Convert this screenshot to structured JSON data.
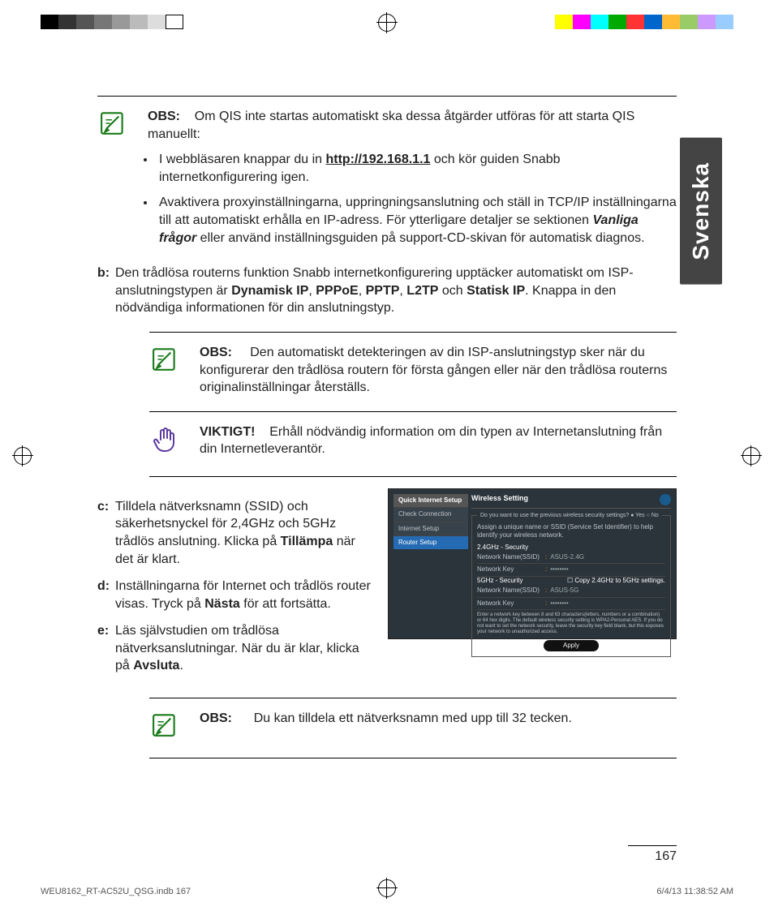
{
  "language_tab": "Svenska",
  "page_number": "167",
  "imprint": {
    "file": "WEU8162_RT-AC52U_QSG.indb   167",
    "stamp": "6/4/13   11:38:52 AM"
  },
  "note1": {
    "label": "OBS:",
    "intro": "Om QIS inte startas automatiskt ska dessa åtgärder utföras för att starta QIS manuellt:",
    "bullet1_a": "I webbläsaren knappar du in ",
    "bullet1_link": "http://192.168.1.1",
    "bullet1_b": " och kör guiden Snabb internetkonfigurering igen.",
    "bullet2_a": "Avaktivera proxyinställningarna, uppringningsanslutning och ställ in TCP/IP inställningarna till att automatiskt erhålla en IP-adress. För ytterligare detaljer se sektionen ",
    "bullet2_em": "Vanliga frågor",
    "bullet2_b": " eller använd inställningsguiden på support-CD-skivan för automatisk diagnos."
  },
  "step_b": {
    "label": "b:",
    "a": "Den trådlösa routerns funktion Snabb internetkonfigurering upptäcker automatiskt om ISP-anslutningstypen är ",
    "b1": "Dynamisk IP",
    "c1": ", ",
    "b2": "PPPoE",
    "c2": ", ",
    "b3": "PPTP",
    "c3": ", ",
    "b4": "L2TP",
    "c4": " och ",
    "b5": "Statisk IP",
    "tail": ". Knappa in den nödvändiga informationen för din anslutningstyp."
  },
  "note2": {
    "label": "OBS:",
    "text": "Den automatiskt detekteringen av din ISP-anslutningstyp sker när du konfigurerar den trådlösa routern för första gången eller när den trådlösa routerns originalinställningar återställs."
  },
  "important": {
    "label": "VIKTIGT!",
    "text": "Erhåll nödvändig information om din typen av Internetanslutning från din Internetleverantör."
  },
  "step_c": {
    "label": "c:",
    "a": "Tilldela nätverksnamn (SSID) och säkerhetsnyckel för 2,4GHz och 5GHz trådlös anslutning. Klicka på ",
    "bold": "Tillämpa",
    "b": " när det är klart."
  },
  "step_d": {
    "label": "d:",
    "a": "Inställningarna för Internet och trådlös router visas. Tryck på ",
    "bold": "Nästa",
    "b": " för att fortsätta."
  },
  "step_e": {
    "label": "e:",
    "a": "Läs självstudien om trådlösa nätverksanslutningar. När du är klar, klicka på ",
    "bold": "Avsluta",
    "b": "."
  },
  "note3": {
    "label": "OBS:",
    "text": "Du kan tilldela ett nätverksnamn med upp till 32 tecken."
  },
  "router": {
    "side_hdr": "Quick Internet Setup",
    "side1": "Check Connection",
    "side2": "Internet Setup",
    "side3": "Router Setup",
    "title": "Wireless Setting",
    "question": "Do you want to use the previous wireless security settings?",
    "yes": "● Yes",
    "no": "○ No",
    "hint": "Assign a unique name or SSID (Service Set Identifier) to help identify your wireless network.",
    "g1": "2.4GHz - Security",
    "f1k": "Network Name(SSID)",
    "f1v": "ASUS-2.4G",
    "f2k": "Network Key",
    "f2v": "••••••••",
    "g2": "5GHz - Security",
    "g2chk": "☐ Copy 2.4GHz to 5GHz settings.",
    "f3k": "Network Name(SSID)",
    "f3v": "ASUS-5G",
    "f4k": "Network Key",
    "f4v": "••••••••",
    "note": "Enter a network key between 8 and 63 characters(letters, numbers or a combination) or 64 hex digits. The default wireless security setting is WPA2-Personal AES. If you do not want to set the network security, leave the security key field blank, but this exposes your network to unauthorized access.",
    "apply": "Apply"
  }
}
